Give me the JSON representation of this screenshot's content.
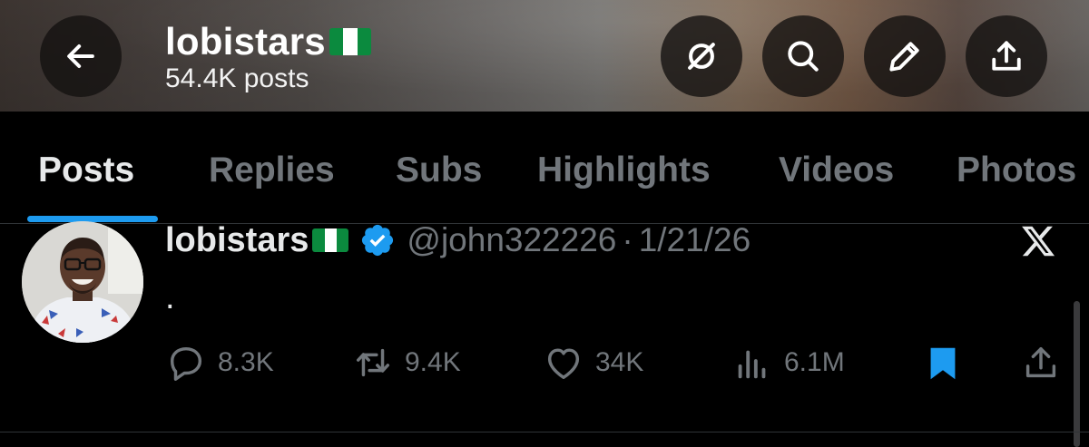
{
  "header": {
    "title": "lobistars",
    "post_count": "54.4K posts",
    "icons": {
      "back": "arrow-left-icon",
      "grok": "grok-icon",
      "search": "search-icon",
      "compose": "pencil-icon",
      "share": "share-upload-icon"
    }
  },
  "tabs": [
    {
      "label": "Posts",
      "active": true
    },
    {
      "label": "Replies",
      "active": false
    },
    {
      "label": "Subs",
      "active": false
    },
    {
      "label": "Highlights",
      "active": false
    },
    {
      "label": "Videos",
      "active": false
    },
    {
      "label": "Photos",
      "active": false
    }
  ],
  "post": {
    "author_name": "lobistars",
    "handle": "@john322226",
    "separator": "·",
    "date": "1/21/26",
    "text": ".",
    "verified": true,
    "stats": {
      "replies": "8.3K",
      "reposts": "9.4K",
      "likes": "34K",
      "views": "6.1M"
    },
    "bookmarked": true
  },
  "colors": {
    "background": "#000000",
    "accent": "#1d9bf0",
    "muted_text": "#71767b",
    "primary_text": "#e7e9ea",
    "flag_green": "#0b8a3e"
  }
}
